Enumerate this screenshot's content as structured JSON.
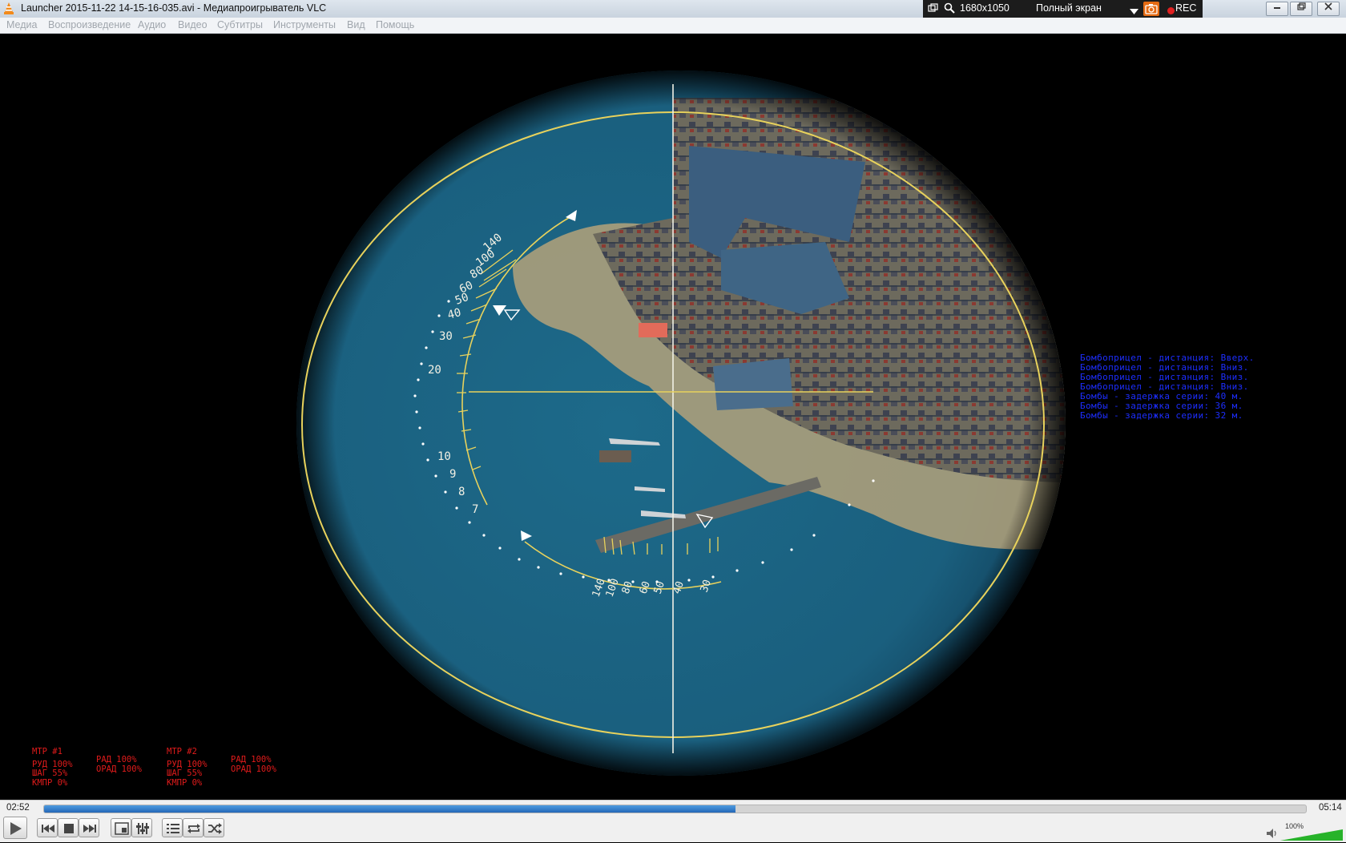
{
  "window": {
    "title": "Launcher 2015-11-22 14-15-16-035.avi - Медиапроигрыватель VLC",
    "icon": "vlc-cone-icon"
  },
  "hud": {
    "resolution": "1680x1050",
    "fullscreen_label": "Полный экран",
    "rec_label": "REC"
  },
  "menu": {
    "items": [
      "Медиа",
      "Воспроизведение",
      "Аудио",
      "Видео",
      "Субтитры",
      "Инструменты",
      "Вид",
      "Помощь"
    ]
  },
  "scope": {
    "range_scale": [
      "140",
      "100",
      "80",
      "60",
      "50",
      "40",
      "30",
      "20",
      "10",
      "9",
      "8",
      "7"
    ],
    "speed_scale": [
      "140",
      "100",
      "80",
      "60",
      "50",
      "40",
      "30"
    ],
    "line_color": "#e8d25c"
  },
  "bombsight": {
    "lines": [
      "Бомбоприцел - дистанция: Вверх.",
      "Бомбоприцел - дистанция: Вниз.",
      "Бомбоприцел - дистанция: Вниз.",
      "Бомбоприцел - дистанция: Вниз.",
      "Бомбы - задержка серии: 40 м.",
      "Бомбы - задержка серии: 36 м.",
      "Бомбы - задержка серии: 32 м."
    ],
    "color": "#1d2eff"
  },
  "engines": [
    {
      "header": "МТР  #1",
      "rud": "РУД  100%",
      "shag": "ШАГ  55%",
      "kmpr": "КМПР 0%",
      "rad": "РАД  100%",
      "orad": "ОРАД 100%"
    },
    {
      "header": "МТР  #2",
      "rud": "РУД  100%",
      "shag": "ШАГ  55%",
      "kmpr": "КМПР 0%",
      "rad": "РАД  100%",
      "orad": "ОРАД 100%"
    }
  ],
  "playback": {
    "elapsed": "02:52",
    "total": "05:14",
    "progress": 0.548,
    "volume_label": "100%",
    "volume": 1.0
  }
}
